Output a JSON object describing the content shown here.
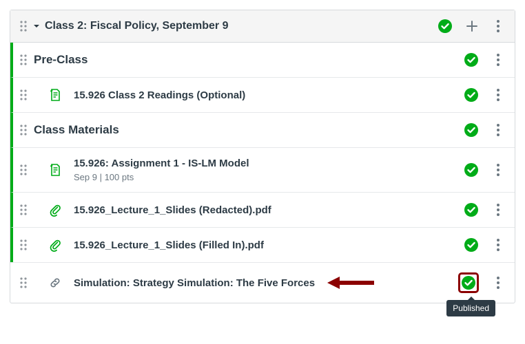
{
  "module": {
    "title": "Class 2: Fiscal Policy, September 9"
  },
  "tooltip": {
    "published": "Published"
  },
  "rows": [
    {
      "title": "Pre-Class"
    },
    {
      "title": "15.926 Class 2 Readings (Optional)"
    },
    {
      "title": "Class Materials"
    },
    {
      "title": "15.926: Assignment 1 - IS-LM Model",
      "sub": "Sep 9  |  100 pts"
    },
    {
      "title": "15.926_Lecture_1_Slides (Redacted).pdf"
    },
    {
      "title": "15.926_Lecture_1_Slides (Filled In).pdf"
    },
    {
      "title": "Simulation: Strategy Simulation: The Five Forces"
    }
  ]
}
